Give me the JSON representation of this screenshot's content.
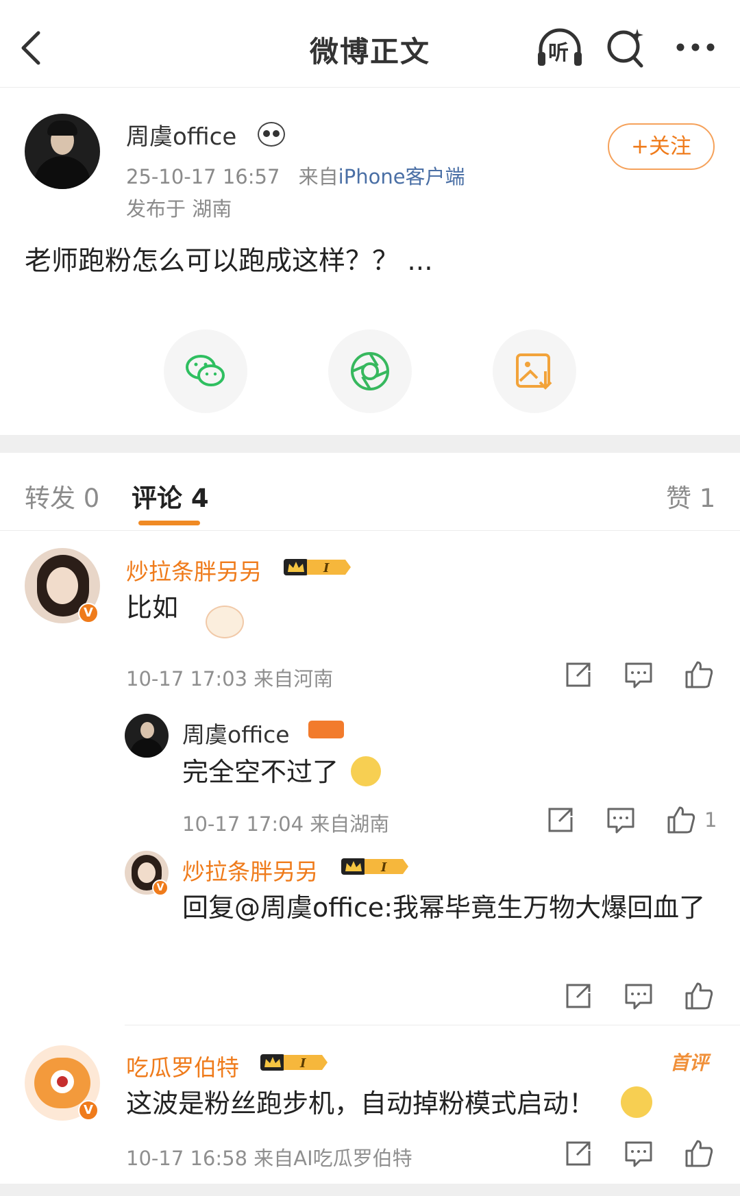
{
  "header": {
    "title": "微博正文",
    "listen_label": "听"
  },
  "post": {
    "author": "周虞office",
    "time": "25-10-17 16:57",
    "source_prefix": "来自",
    "source": "iPhone客户端",
    "location": "发布于 湖南",
    "follow_label": "+关注",
    "text": "老师跑粉怎么可以跑成这样？？ ..."
  },
  "share": [
    {
      "icon": "wechat-icon",
      "color": "#2fbf60"
    },
    {
      "icon": "moments-icon",
      "color": "#37b85e"
    },
    {
      "icon": "save-image-icon",
      "color": "#f2a33a"
    }
  ],
  "tabs": {
    "repost": "转发 0",
    "comments": "评论 4",
    "likes": "赞 1"
  },
  "comments": [
    {
      "name": "炒拉条胖另另",
      "text": "比如",
      "meta": "10-17 17:03  来自河南"
    },
    {
      "name": "周虞office",
      "text": "完全空不过了",
      "meta": "10-17 17:04  来自湖南",
      "likes": "1"
    },
    {
      "name": "炒拉条胖另另",
      "text": "回复@周虞office:我幂毕竟生万物大爆回血了",
      "meta": ""
    },
    {
      "name": "吃瓜罗伯特",
      "badge": "首评",
      "text": "这波是粉丝跑步机，自动掉粉模式启动！",
      "meta": "10-17 16:58  来自AI吃瓜罗伯特"
    }
  ],
  "colors": {
    "accent": "#ef7b1b",
    "gray_text": "#8a8a8a",
    "band": "#efefef"
  }
}
